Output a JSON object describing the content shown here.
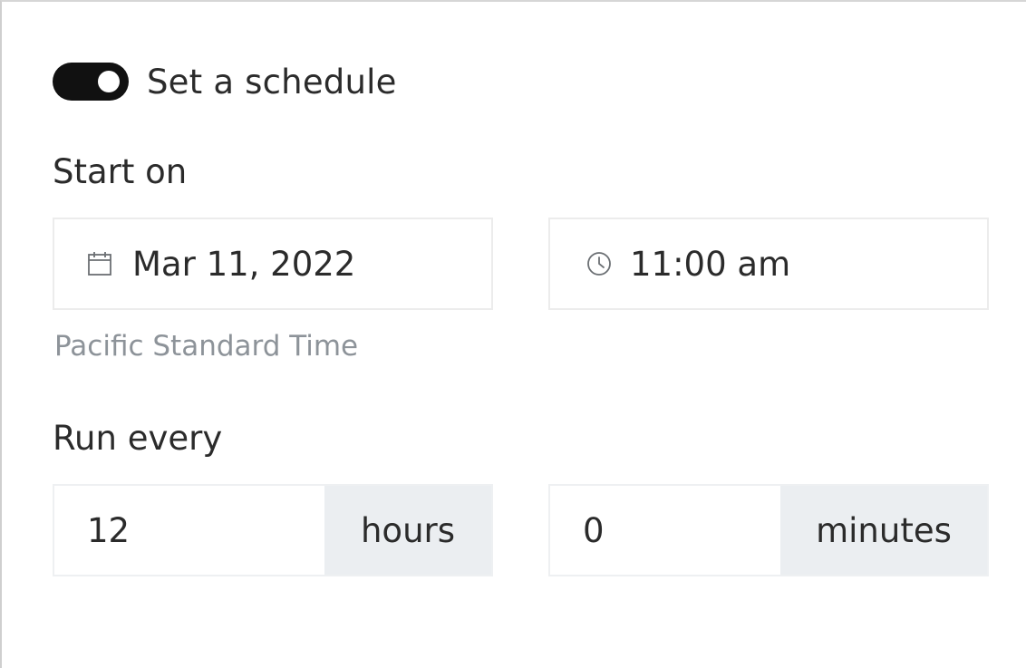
{
  "schedule": {
    "toggle_label": "Set a schedule",
    "toggle_on": true,
    "start_on_label": "Start on",
    "date_value": "Mar 11, 2022",
    "time_value": "11:00 am",
    "timezone": "Pacific Standard Time",
    "run_every_label": "Run every",
    "hours_value": "12",
    "hours_unit": "hours",
    "minutes_value": "0",
    "minutes_unit": "minutes"
  },
  "icons": {
    "date": "calendar-icon",
    "time": "clock-icon"
  },
  "colors": {
    "toggle_bg": "#111111",
    "field_border": "#ececec",
    "addon_bg": "#ebeef1",
    "helper_text": "#8d9399"
  }
}
